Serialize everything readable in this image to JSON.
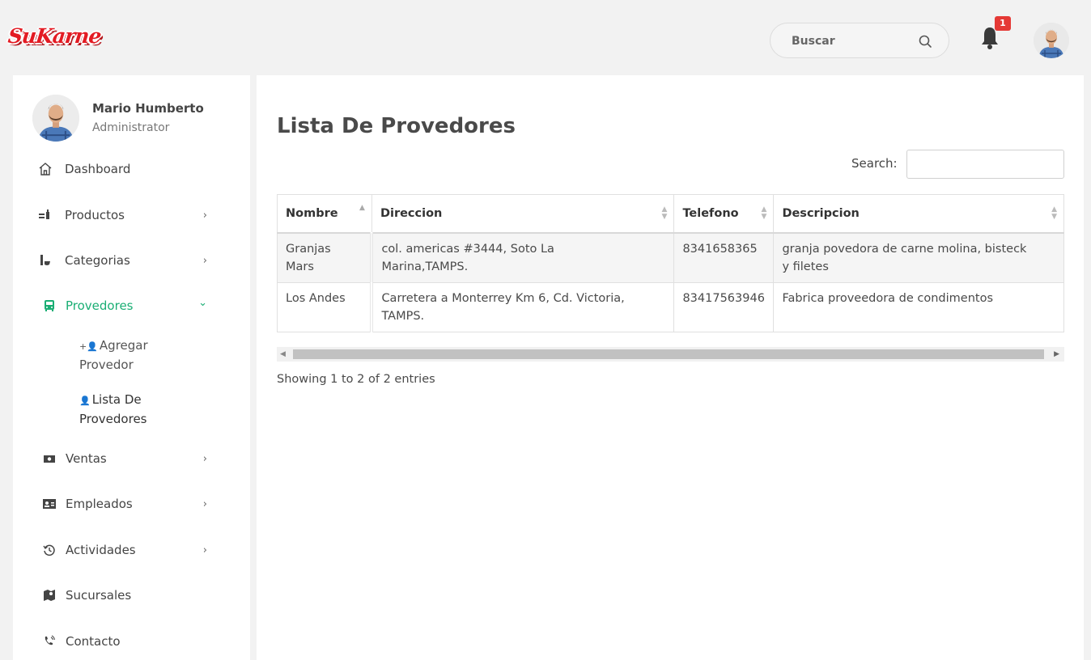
{
  "brand": {
    "logo_text": "SuKarne",
    "accent": "#e31b23",
    "green": "#1aae74"
  },
  "header": {
    "search_placeholder": "Buscar",
    "notifications_count": "1"
  },
  "profile": {
    "name": "Mario Humberto",
    "role": "Administrator"
  },
  "sidebar": {
    "items": [
      {
        "label": "Dashboard",
        "icon": "home-icon",
        "has_chevron": false
      },
      {
        "label": "Productos",
        "icon": "products-icon",
        "chevron": "›"
      },
      {
        "label": "Categorias",
        "icon": "categories-icon",
        "chevron": "›"
      },
      {
        "label": "Provedores",
        "icon": "bus-icon",
        "chevron": "⌄",
        "active": true
      },
      {
        "label": "Ventas",
        "icon": "money-icon",
        "chevron": "›"
      },
      {
        "label": "Empleados",
        "icon": "id-card-icon",
        "chevron": "›"
      },
      {
        "label": "Actividades",
        "icon": "history-icon",
        "chevron": "›"
      },
      {
        "label": "Sucursales",
        "icon": "map-icon",
        "has_chevron": false
      },
      {
        "label": "Contacto",
        "icon": "phone-icon",
        "has_chevron": false
      }
    ],
    "subitems": [
      {
        "label_line1": "Agregar",
        "label_line2": "Provedor",
        "icon": "user-plus-icon"
      },
      {
        "label_line1": "Lista De",
        "label_line2": "Provedores",
        "icon": "user-cog-icon"
      }
    ]
  },
  "main": {
    "title": "Lista De Provedores",
    "search_label": "Search:",
    "table": {
      "columns": [
        "Nombre",
        "Direccion",
        "Telefono",
        "Descripcion"
      ],
      "rows": [
        {
          "nombre": [
            "Granjas",
            "Mars"
          ],
          "direccion": [
            "col. americas #3444, Soto La",
            "Marina,TAMPS."
          ],
          "telefono": "8341658365",
          "descripcion": [
            "granja povedora de carne molina, bisteck",
            "y filetes"
          ]
        },
        {
          "nombre": [
            "Los Andes"
          ],
          "direccion": [
            "Carretera a Monterrey Km 6, Cd. Victoria,",
            "TAMPS."
          ],
          "telefono": "83417563946",
          "descripcion": [
            "Fabrica proveedora de condimentos"
          ]
        }
      ]
    },
    "info": "Showing 1 to 2 of 2 entries"
  }
}
